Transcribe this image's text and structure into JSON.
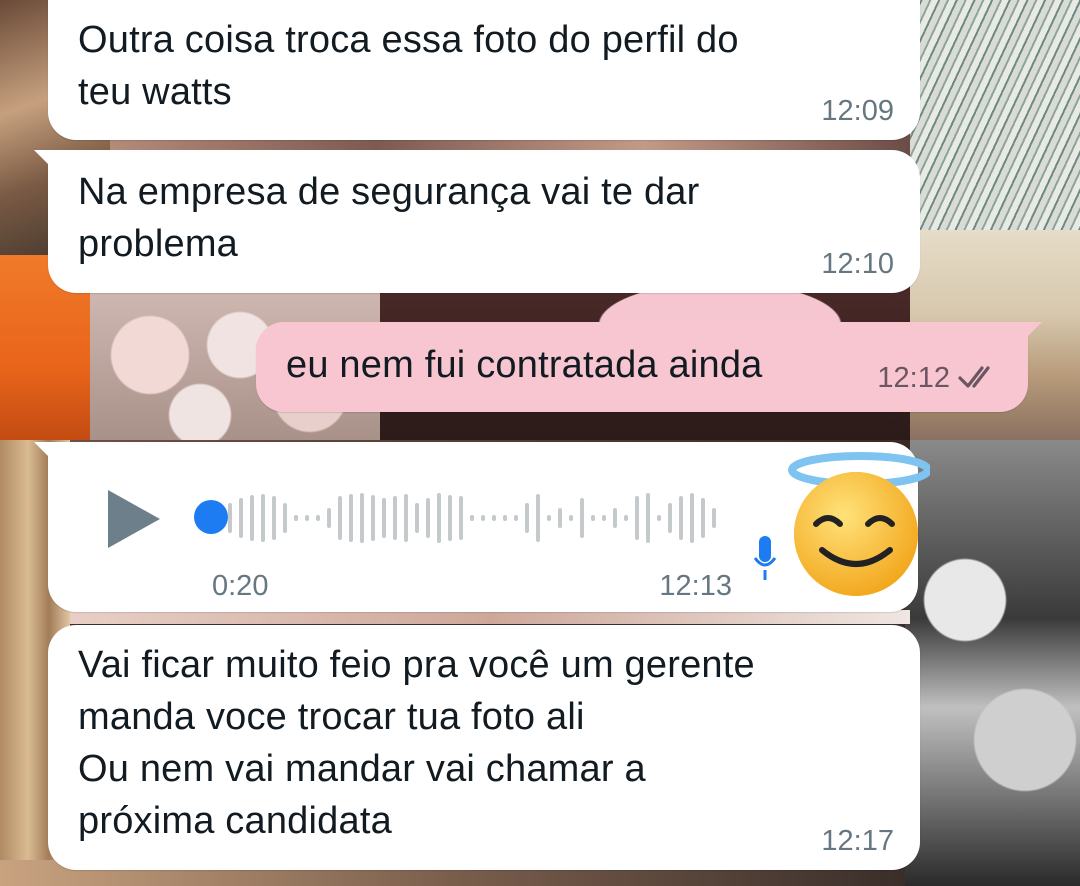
{
  "messages": [
    {
      "direction": "incoming",
      "text": "Outra coisa  troca essa foto do perfil do\nteu watts",
      "time": "12:09"
    },
    {
      "direction": "incoming",
      "text": "Na empresa de segurança vai te dar\nproblema",
      "time": "12:10"
    },
    {
      "direction": "outgoing",
      "text": "eu nem fui contratada ainda",
      "time": "12:12",
      "status": "read-double-check"
    },
    {
      "direction": "incoming",
      "type": "voice",
      "duration": "0:20",
      "time": "12:13",
      "progress": 0
    },
    {
      "direction": "incoming",
      "text": "Vai ficar muito feio pra você  um gerente\nmanda voce trocar tua foto ali\nOu nem vai mandar vai chamar a\npróxima candidata",
      "time": "12:17"
    }
  ],
  "voice": {
    "play_icon": "play-icon",
    "mic_icon": "microphone-icon",
    "avatar_emoji": "😇",
    "accent": "#1d7cf2"
  },
  "colors": {
    "incoming_bubble": "#ffffff",
    "outgoing_bubble": "#f7c6d1",
    "text": "#111b21",
    "meta": "#667781"
  }
}
